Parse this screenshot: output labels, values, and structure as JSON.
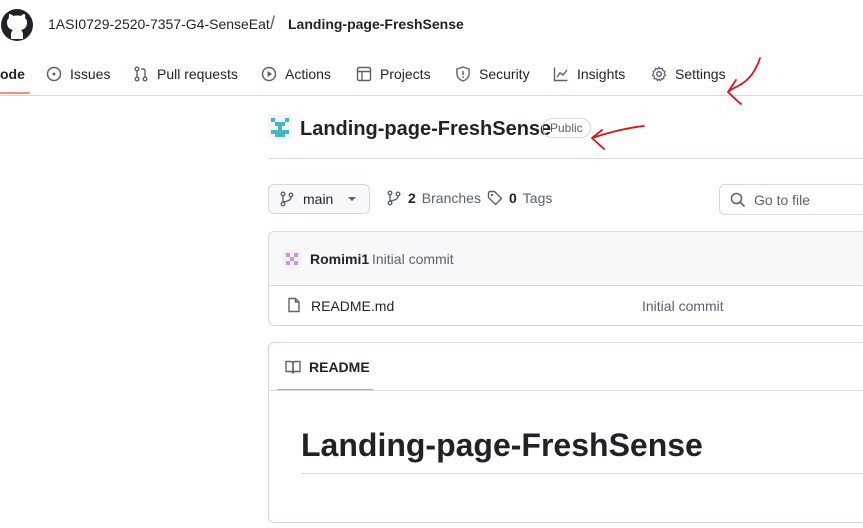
{
  "header": {
    "owner": "1ASI0729-2520-7357-G4-SenseEat",
    "separator": "/",
    "repo": "Landing-page-FreshSense"
  },
  "nav": {
    "tabs": [
      {
        "label": "ode",
        "icon": "code-icon",
        "active": true
      },
      {
        "label": "Issues",
        "icon": "issue-opened-icon"
      },
      {
        "label": "Pull requests",
        "icon": "git-pull-request-icon"
      },
      {
        "label": "Actions",
        "icon": "play-icon"
      },
      {
        "label": "Projects",
        "icon": "table-icon"
      },
      {
        "label": "Security",
        "icon": "shield-icon"
      },
      {
        "label": "Insights",
        "icon": "graph-icon"
      },
      {
        "label": "Settings",
        "icon": "gear-icon"
      }
    ]
  },
  "repo": {
    "title": "Landing-page-FreshSense",
    "visibility": "Public"
  },
  "toolbar": {
    "branch": "main",
    "branches_count": "2",
    "branches_label": "Branches",
    "tags_count": "0",
    "tags_label": "Tags",
    "goto_placeholder": "Go to file"
  },
  "commit": {
    "author": "Romimi1",
    "message": "Initial commit"
  },
  "files": [
    {
      "name": "README.md",
      "commit": "Initial commit"
    }
  ],
  "readme": {
    "tab": "README",
    "heading": "Landing-page-FreshSense"
  },
  "colors": {
    "accent_underline": "#fd8c73",
    "annotation": "#e0111b"
  }
}
